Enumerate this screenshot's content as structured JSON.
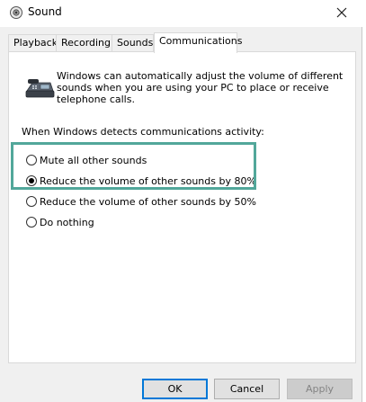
{
  "window": {
    "title": "Sound",
    "close_icon": "close-icon",
    "app_icon": "speaker-icon"
  },
  "tabs": [
    {
      "label": "Playback",
      "active": false
    },
    {
      "label": "Recording",
      "active": false
    },
    {
      "label": "Sounds",
      "active": false
    },
    {
      "label": "Communications",
      "active": true
    }
  ],
  "communications": {
    "icon": "telephone-icon",
    "description": "Windows can automatically adjust the volume of different sounds when you are using your PC to place or receive telephone calls.",
    "detect_label": "When Windows detects communications activity:",
    "options": [
      {
        "label": "Mute all other sounds",
        "checked": false
      },
      {
        "label": "Reduce the volume of other sounds by 80%",
        "checked": true
      },
      {
        "label": "Reduce the volume of other sounds by 50%",
        "checked": false
      },
      {
        "label": "Do nothing",
        "checked": false
      }
    ],
    "highlight_color": "#52a79a"
  },
  "buttons": {
    "ok": "OK",
    "cancel": "Cancel",
    "apply": "Apply"
  }
}
